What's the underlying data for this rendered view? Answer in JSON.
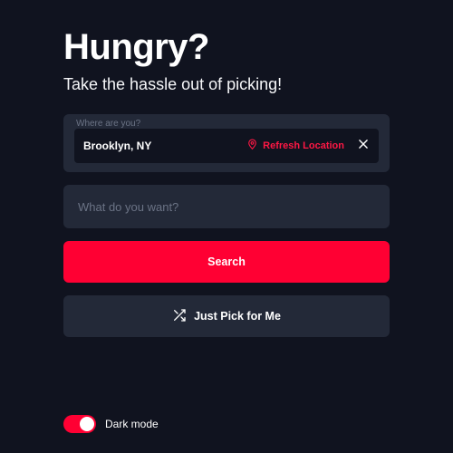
{
  "header": {
    "title": "Hungry?",
    "subtitle": "Take the hassle out of picking!"
  },
  "location": {
    "float_label": "Where are you?",
    "value": "Brooklyn, NY",
    "refresh_label": "Refresh Location"
  },
  "query": {
    "placeholder": "What do you want?"
  },
  "buttons": {
    "search": "Search",
    "random": "Just Pick for Me"
  },
  "darkmode": {
    "label": "Dark mode",
    "on": true
  },
  "colors": {
    "accent": "#ff0033",
    "bg": "#10131f",
    "panel": "#232938"
  }
}
